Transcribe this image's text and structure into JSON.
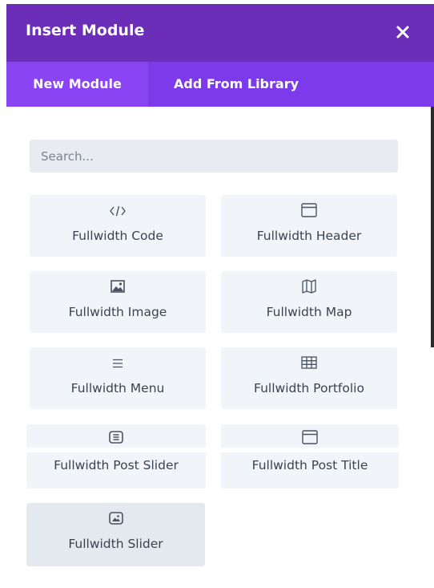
{
  "modal": {
    "title": "Insert Module",
    "close_icon": "close-icon"
  },
  "tabs": [
    {
      "label": "New Module",
      "active": true
    },
    {
      "label": "Add From Library",
      "active": false
    }
  ],
  "search": {
    "placeholder": "Search...",
    "value": ""
  },
  "modules": [
    {
      "label": "Fullwidth Code",
      "icon": "code-icon"
    },
    {
      "label": "Fullwidth Header",
      "icon": "window-icon"
    },
    {
      "label": "Fullwidth Image",
      "icon": "image-icon"
    },
    {
      "label": "Fullwidth Map",
      "icon": "map-icon"
    },
    {
      "label": "Fullwidth Menu",
      "icon": "menu-icon"
    },
    {
      "label": "Fullwidth Portfolio",
      "icon": "grid-icon"
    },
    {
      "label": "Fullwidth Post Slider",
      "icon": "slider-icon"
    },
    {
      "label": "Fullwidth Post Title",
      "icon": "window-icon"
    },
    {
      "label": "Fullwidth Slider",
      "icon": "slider-image-icon"
    }
  ],
  "colors": {
    "header": "#6c2eb9",
    "tabbar": "#7c3aea",
    "active_tab": "#8b44f4",
    "tile": "#f1f4f8"
  }
}
